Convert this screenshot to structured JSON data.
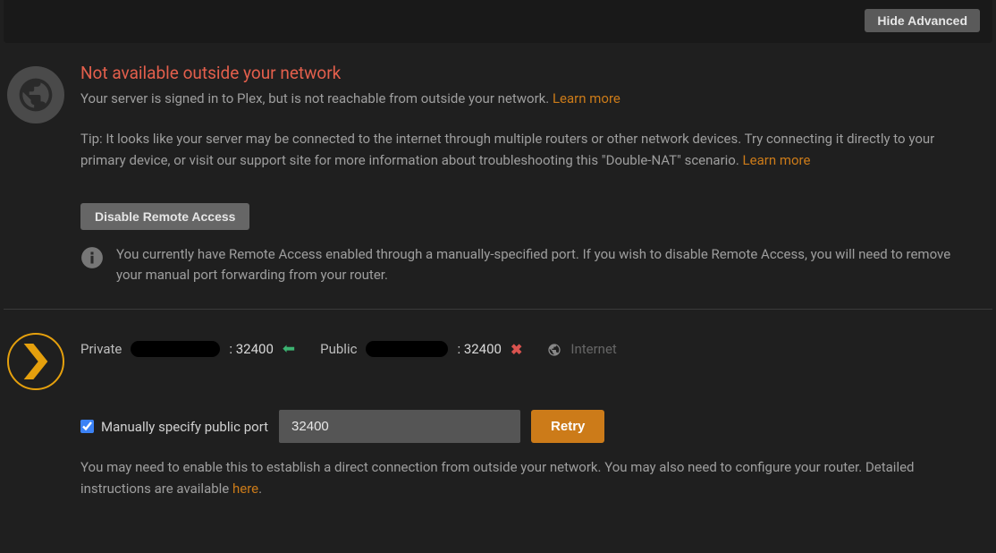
{
  "toolbar": {
    "hide_advanced": "Hide Advanced"
  },
  "status": {
    "heading": "Not available outside your network",
    "subtext": "Your server is signed in to Plex, but is not reachable from outside your network. ",
    "learn_more": "Learn more",
    "tip": "Tip: It looks like your server may be connected to the internet through multiple routers or other network devices. Try connecting it directly to your primary device, or visit our support site for more information about troubleshooting this \"Double-NAT\" scenario. ",
    "tip_learn_more": "Learn more",
    "disable_button": "Disable Remote Access",
    "alert": "You currently have Remote Access enabled through a manually-specified port. If you wish to disable Remote Access, you will need to remove your manual port forwarding from your router."
  },
  "connection": {
    "private_label": "Private",
    "private_port": "32400",
    "public_label": "Public",
    "public_port": "32400",
    "internet_label": "Internet"
  },
  "manual": {
    "checkbox_label": "Manually specify public port",
    "port_value": "32400",
    "retry_button": "Retry",
    "help_text_1": "You may need to enable this to establish a direct connection from outside your network. You may also need to configure your router. Detailed instructions are available ",
    "help_link": "here",
    "help_text_2": "."
  }
}
